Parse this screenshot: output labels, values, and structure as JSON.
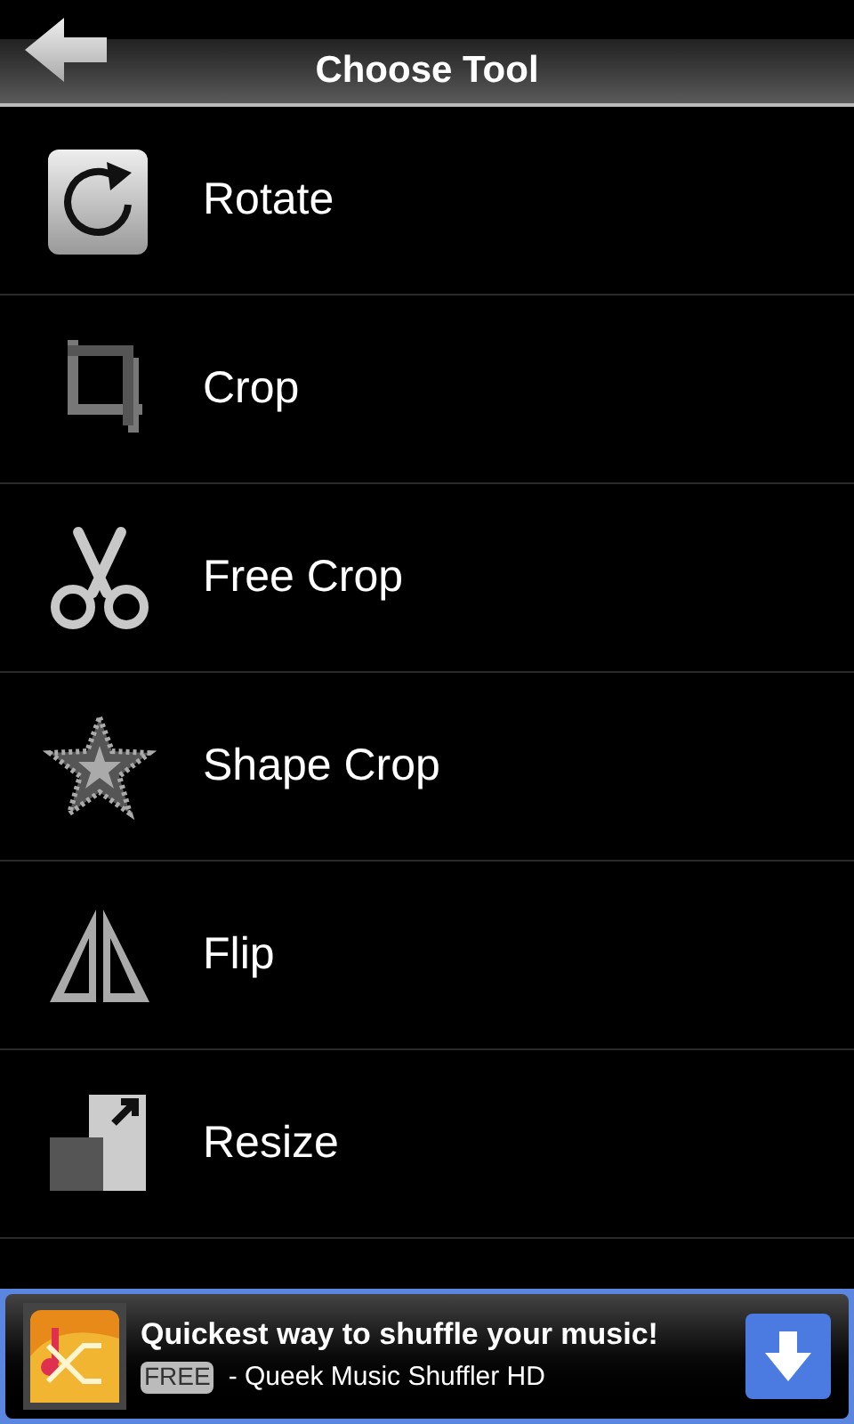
{
  "header": {
    "title": "Choose Tool"
  },
  "tools": [
    {
      "kind": "rotate",
      "label": "Rotate"
    },
    {
      "kind": "crop",
      "label": "Crop"
    },
    {
      "kind": "freecrop",
      "label": "Free Crop"
    },
    {
      "kind": "shapecrop",
      "label": "Shape Crop"
    },
    {
      "kind": "flip",
      "label": "Flip"
    },
    {
      "kind": "resize",
      "label": "Resize"
    }
  ],
  "ad": {
    "headline": "Quickest way to shuffle your music!",
    "badge": "FREE",
    "subtitle": "- Queek Music Shuffler HD"
  }
}
